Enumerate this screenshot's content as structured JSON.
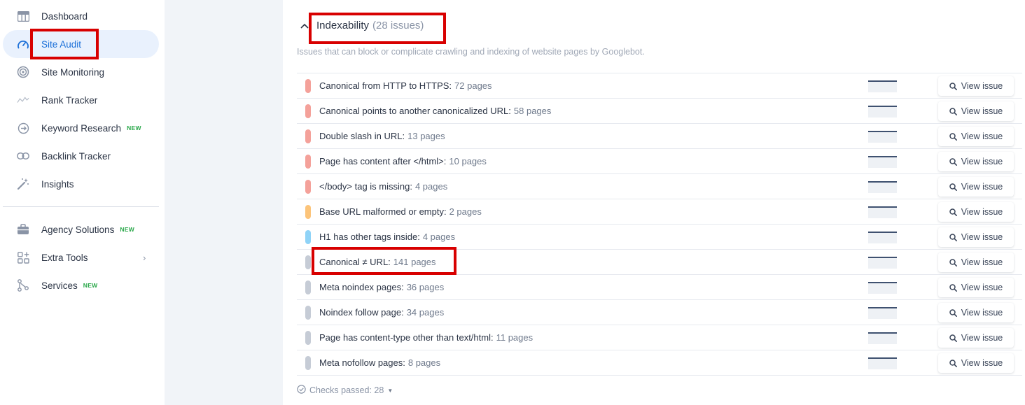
{
  "sidebar": {
    "items": [
      {
        "label": "Dashboard",
        "icon": "dashboard-icon",
        "badge": ""
      },
      {
        "label": "Site Audit",
        "icon": "speedometer-icon",
        "badge": "",
        "active": true
      },
      {
        "label": "Site Monitoring",
        "icon": "radar-icon",
        "badge": ""
      },
      {
        "label": "Rank Tracker",
        "icon": "trend-line-icon",
        "badge": ""
      },
      {
        "label": "Keyword Research",
        "icon": "target-icon",
        "badge": "NEW"
      },
      {
        "label": "Backlink Tracker",
        "icon": "link-icon",
        "badge": ""
      },
      {
        "label": "Insights",
        "icon": "magic-wand-icon",
        "badge": ""
      }
    ],
    "items2": [
      {
        "label": "Agency Solutions",
        "icon": "briefcase-icon",
        "badge": "NEW"
      },
      {
        "label": "Extra Tools",
        "icon": "grid-plus-icon",
        "badge": ""
      },
      {
        "label": "Services",
        "icon": "nodes-icon",
        "badge": "NEW"
      }
    ]
  },
  "section": {
    "title": "Indexability",
    "count": "(28 issues)",
    "description": "Issues that can block or complicate crawling and indexing of website pages by Googlebot."
  },
  "issues": [
    {
      "label": "Canonical from HTTP to HTTPS:",
      "pages": "72 pages",
      "severity_color": "#f4a19a",
      "button": "View issue"
    },
    {
      "label": "Canonical points to another canonicalized URL:",
      "pages": "58 pages",
      "severity_color": "#f4a19a",
      "button": "View issue"
    },
    {
      "label": "Double slash in URL:",
      "pages": "13 pages",
      "severity_color": "#f4a19a",
      "button": "View issue"
    },
    {
      "label": "Page has content after </html>:",
      "pages": "10 pages",
      "severity_color": "#f4a19a",
      "button": "View issue"
    },
    {
      "label": "</body> tag is missing:",
      "pages": "4 pages",
      "severity_color": "#f4a19a",
      "button": "View issue"
    },
    {
      "label": "Base URL malformed or empty:",
      "pages": "2 pages",
      "severity_color": "#fcc47a",
      "button": "View issue"
    },
    {
      "label": "H1 has other tags inside:",
      "pages": "4 pages",
      "severity_color": "#8fd3f7",
      "button": "View issue"
    },
    {
      "label": "Canonical ≠ URL:",
      "pages": "141 pages",
      "severity_color": "#c6ccd6",
      "button": "View issue"
    },
    {
      "label": "Meta noindex pages:",
      "pages": "36 pages",
      "severity_color": "#c6ccd6",
      "button": "View issue"
    },
    {
      "label": "Noindex follow page:",
      "pages": "34 pages",
      "severity_color": "#c6ccd6",
      "button": "View issue"
    },
    {
      "label": "Page has content-type other than text/html:",
      "pages": "11 pages",
      "severity_color": "#c6ccd6",
      "button": "View issue"
    },
    {
      "label": "Meta nofollow pages:",
      "pages": "8 pages",
      "severity_color": "#c6ccd6",
      "button": "View issue"
    }
  ],
  "checks_passed": "Checks passed: 28",
  "colors": {
    "accent": "#1a6fd8",
    "highlight": "#d80000",
    "active_bg": "#e9f1fd"
  }
}
